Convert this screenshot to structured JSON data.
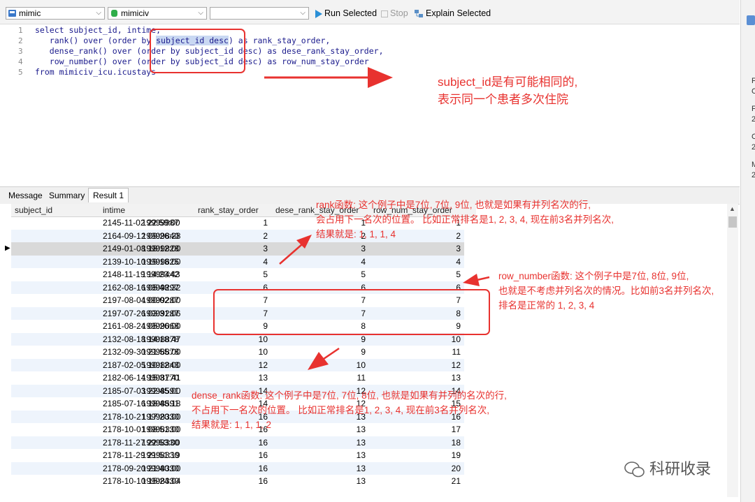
{
  "toolbar": {
    "connection": "mimic",
    "database": "mimiciv",
    "schema": "",
    "run_selected": "Run Selected",
    "stop": "Stop",
    "explain_selected": "Explain Selected"
  },
  "editor": {
    "line_numbers": [
      "1",
      "2",
      "3",
      "4",
      "5"
    ],
    "lines": [
      [
        "select subject_id, intime,"
      ],
      [
        "   rank() over (order by ",
        "subject_id desc",
        ") as rank_stay_order,"
      ],
      [
        "   dense_rank() over (order by subject_id desc) as dese_rank_stay_order,"
      ],
      [
        "   row_number() over (order by subject_id desc) as row_num_stay_order"
      ],
      [
        "from mimiciv_icu.icustays"
      ]
    ]
  },
  "right_strip": [
    "F",
    "C",
    "F",
    "2",
    "C",
    "2",
    "M",
    "2"
  ],
  "tabs": [
    "Message",
    "Summary",
    "Result 1"
  ],
  "grid": {
    "columns": [
      "subject_id",
      "intime",
      "rank_stay_order",
      "dese_rank_stay_order",
      "row_num_stay_order"
    ],
    "rows": [
      [
        "19999987",
        "2145-11-02 22:59:00",
        "1",
        "1",
        "1"
      ],
      [
        "19999840",
        "2164-09-12 09:26:28",
        "2",
        "2",
        "2"
      ],
      [
        "19999828",
        "2149-01-08 18:12:00",
        "3",
        "3",
        "3"
      ],
      [
        "19999625",
        "2139-10-10 19:18:00",
        "4",
        "4",
        "4"
      ],
      [
        "19999442",
        "2148-11-19 14:23:43",
        "5",
        "5",
        "5"
      ],
      [
        "19999297",
        "2162-08-16 05:48:32",
        "6",
        "6",
        "6"
      ],
      [
        "19999287",
        "2197-08-04 00:02:00",
        "7",
        "7",
        "7"
      ],
      [
        "19999287",
        "2197-07-26 03:31:06",
        "7",
        "7",
        "8"
      ],
      [
        "19999068",
        "2161-08-24 05:26:00",
        "9",
        "8",
        "9"
      ],
      [
        "19998878",
        "2132-08-18 14:18:47",
        "10",
        "9",
        "10"
      ],
      [
        "19998878",
        "2132-09-30 21:55:00",
        "10",
        "9",
        "11"
      ],
      [
        "19998843",
        "2187-02-05 10:12:00",
        "12",
        "10",
        "12"
      ],
      [
        "19998770",
        "2182-06-14 15:31:41",
        "13",
        "11",
        "13"
      ],
      [
        "19998591",
        "2185-07-03 22:45:00",
        "14",
        "12",
        "14"
      ],
      [
        "19998591",
        "2185-07-16 18:48:18",
        "14",
        "12",
        "15"
      ],
      [
        "19998330",
        "2178-10-21 17:20:00",
        "16",
        "13",
        "16"
      ],
      [
        "19998330",
        "2178-10-01 08:51:00",
        "16",
        "13",
        "17"
      ],
      [
        "19998330",
        "2178-11-27 22:53:00",
        "16",
        "13",
        "18"
      ],
      [
        "19998330",
        "2178-11-29 21:51:19",
        "16",
        "13",
        "19"
      ],
      [
        "19998330",
        "2178-09-20 21:40:00",
        "16",
        "13",
        "20"
      ],
      [
        "19998330",
        "2178-10-10 15:24:04",
        "16",
        "13",
        "21"
      ]
    ]
  },
  "annotations": {
    "subject": [
      "subject_id是有可能相同的,",
      "表示同一个患者多次住院"
    ],
    "rank": [
      "rank函数: 这个例子中是7位, 7位, 9位, 也就是如果有并列名次的行,",
      "会占用下一名次的位置。 比如正常排名是1, 2, 3, 4, 现在前3名并列名次,",
      "结果就是: 1, 1, 1, 4"
    ],
    "row_number": [
      "row_number函数: 这个例子中是7位, 8位, 9位,",
      "也就是不考虑并列名次的情况。比如前3名并列名次,",
      "排名是正常的 1, 2, 3, 4"
    ],
    "dense_rank": [
      "dense_rank函数: 这个例子中是7位, 7位, 8位, 也就是如果有并列的名次的行,",
      "不占用下一名次的位置。 比如正常排名是1, 2, 3, 4, 现在前3名并列名次,",
      "结果就是: 1, 1, 1, 2"
    ]
  },
  "watermark": "科研收录",
  "colors": {
    "annotation": "#e8322f",
    "keyword": "#1b3fc4",
    "alt_row": "#eef4fc",
    "selected_row": "#d9d9d9"
  }
}
